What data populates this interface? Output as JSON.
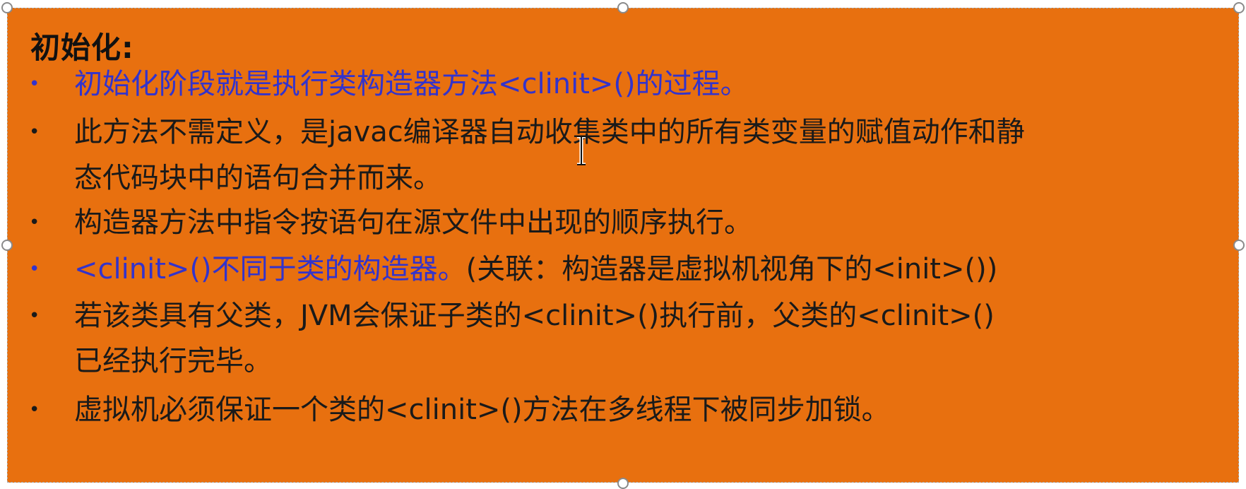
{
  "slide": {
    "heading": "初始化:",
    "bullets": [
      {
        "line1": "初始化阶段就是执行类构造器方法<clinit>()的过程。",
        "line2": "",
        "color": "#3333cc"
      },
      {
        "line1": "此方法不需定义，是javac编译器自动收集类中的所有类变量的赋值动作和静",
        "line2": "态代码块中的语句合并而来。",
        "color": "#1a1a1a"
      },
      {
        "line1": "构造器方法中指令按语句在源文件中出现的顺序执行。",
        "line2": "",
        "color": "#1a1a1a"
      },
      {
        "line1_blue": "<clinit>()不同于类的构造器。",
        "line1_rest": "(关联：构造器是虚拟机视角下的<init>())",
        "color": "#3333cc"
      },
      {
        "line1": "若该类具有父类，JVM会保证子类的<clinit>()执行前，父类的<clinit>()",
        "line2": "已经执行完毕。",
        "color": "#1a1a1a"
      },
      {
        "line1": "虚拟机必须保证一个类的<clinit>()方法在多线程下被同步加锁。",
        "line2": "",
        "color": "#1a1a1a"
      }
    ],
    "bullet_glyph": "•",
    "background_color": "#e8700f",
    "accent_color": "#3333cc"
  }
}
